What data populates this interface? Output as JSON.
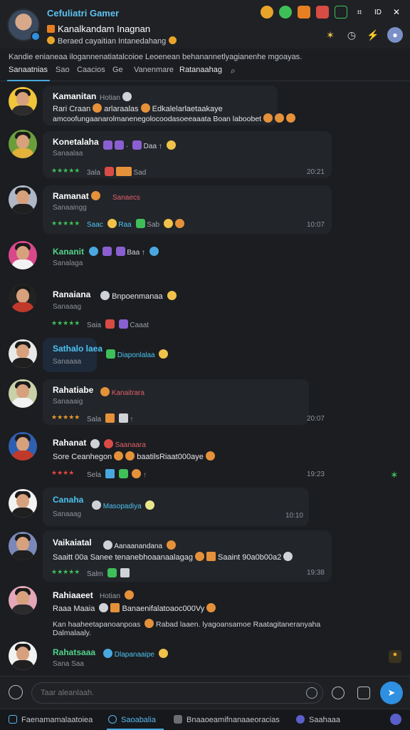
{
  "header": {
    "app_title": "Cefuliatri Gamer",
    "channel_name": "Kanalkandam Inagnan",
    "channel_sub": "Beraed cayaitian Intanedahang",
    "topic_line": "Kandie enianeaa ilogannenatiatalcoioe Leoenean behanannetlyagianenhe mgoayas."
  },
  "filters": [
    "Sanaatnias",
    "Sao",
    "Caacios",
    "Ge",
    "Vanenmare",
    "Ratanaahag"
  ],
  "messages": [
    {
      "name": "Kamanitan",
      "tag": "Hotian",
      "line1": "Rari Craan",
      "line1b": "arlaraalas",
      "line1c": "Edkalelarlaetaakaye",
      "line2": "amcoofungaanarolmanenegolocoodasoeeaaata Boan laboobet",
      "time": ""
    },
    {
      "name": "Konetalaha",
      "tag": "Daa",
      "sub": "Sanaalaa",
      "meta1": "3ala",
      "meta2": "Sad",
      "time": "20:21"
    },
    {
      "name": "Ramanat",
      "tag": "Sanaecs",
      "sub": "Sanaaingg",
      "meta1": "Saac",
      "meta2": "Raa",
      "meta3": "Sab",
      "time": "10:07"
    },
    {
      "name": "Kananit",
      "tag": "Baa",
      "sub": "Sanalaga"
    },
    {
      "name": "Ranaiana",
      "tag": "Bnpoenmanaa",
      "sub": "Sanaaag",
      "meta1": "Saia",
      "meta2": "Caaat"
    },
    {
      "name": "Sathalo laea",
      "tag": "Diaponlalaa",
      "sub": "Sanaaaa"
    },
    {
      "name": "Rahatiabe",
      "tag": "Kanaitrara",
      "sub": "Sanaaaig",
      "meta1": "Sala",
      "time": "20:07"
    },
    {
      "name": "Rahanat",
      "tag": "Saanaara",
      "line1": "Sore Ceanhegon",
      "line1b": "baatilsRiaat000aye",
      "meta1": "Sela",
      "time": "19:23"
    },
    {
      "name": "Canaha",
      "tag": "Masopadiya",
      "sub": "Sanaaag",
      "time": "10:10"
    },
    {
      "name": "Vaikaiatal",
      "tag": "Aanaanandana",
      "line1": "Saaitt 00a Sanee",
      "line1b": "tenanebhoaanaalagag",
      "line1c": "Saaint 90a0b00a2",
      "meta1": "Salm",
      "time": "19:38"
    },
    {
      "name": "Rahiaaeet",
      "tag": "Hotian",
      "line1": "Raaa Maaia",
      "line1b": "Banaenifalatoaoc000Vy",
      "line2": "Kan haaheetapanoanpoas",
      "line2b": "Rabad laaen. lyagoansamoe Raatagitaneranyaha",
      "line3": "Dalmalaaly."
    },
    {
      "name": "Rahatsaaa",
      "tag": "Dlapanaaipe",
      "sub": "Sana Saa"
    }
  ],
  "composer": {
    "placeholder": "Taar aleanlaah."
  },
  "bottom_nav": [
    "Faenamamalaatoiea",
    "Saoabalia",
    "Bnaaoeamifnanaaeoracias",
    "Saahaaa"
  ],
  "colors": {
    "accent": "#4aa8e0",
    "background": "#1b1d21",
    "bubble": "#22252a",
    "stars_green": "#3fbf58",
    "stars_orange": "#e59a2c",
    "stars_red": "#e5463d"
  }
}
